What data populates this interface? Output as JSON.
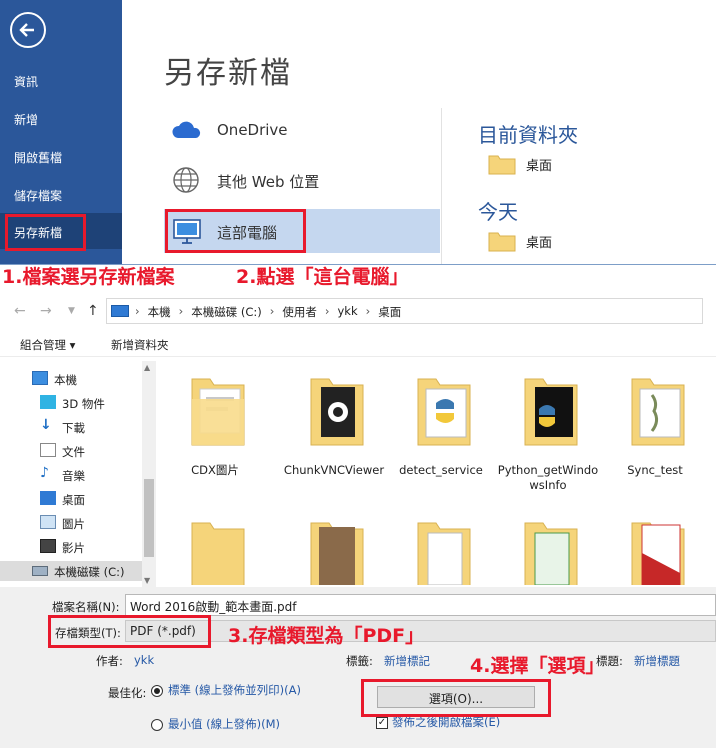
{
  "backstage": {
    "nav": [
      "資訊",
      "新增",
      "開啟舊檔",
      "儲存檔案",
      "另存新檔"
    ],
    "title": "另存新檔",
    "locations": [
      "OneDrive",
      "其他 Web 位置",
      "這部電腦"
    ],
    "current_folder_heading": "目前資料夾",
    "current_folder": "桌面",
    "today_heading": "今天",
    "today_folder": "桌面"
  },
  "annotations": {
    "step1": "1.檔案選另存新檔案",
    "step2": "2.點選「這台電腦」",
    "step3": "3.存檔類型為「PDF」",
    "step4": "4.選擇「選項」"
  },
  "dialog": {
    "breadcrumb": [
      "本機",
      "本機磁碟 (C:)",
      "使用者",
      "ykk",
      "桌面"
    ],
    "organize": "組合管理 ▾",
    "new_folder": "新增資料夾",
    "tree": [
      "本機",
      "3D 物件",
      "下載",
      "文件",
      "音樂",
      "桌面",
      "圖片",
      "影片",
      "本機磁碟 (C:)"
    ],
    "files": [
      "CDX圖片",
      "ChunkVNCViewer",
      "detect_service",
      "Python_getWindowsInfo",
      "Sync_test"
    ],
    "filename_label": "檔案名稱(N):",
    "filename": "Word 2016啟動_範本畫面.pdf",
    "filetype_label": "存檔類型(T):",
    "filetype": "PDF (*.pdf)",
    "author_label": "作者:",
    "author": "ykk",
    "tags_label": "標籤:",
    "tags": "新增標記",
    "subject_label": "標題:",
    "subject": "新增標題",
    "optimize_label": "最佳化:",
    "opt_standard": "標準 (線上發佈並列印)(A)",
    "opt_minimum": "最小值 (線上發佈)(M)",
    "options_button": "選項(O)...",
    "open_after": "發佈之後開啟檔案(E)"
  },
  "colors": {
    "accent": "#2b579a",
    "annotation": "#e8192c",
    "folder": "#f5d47a"
  }
}
